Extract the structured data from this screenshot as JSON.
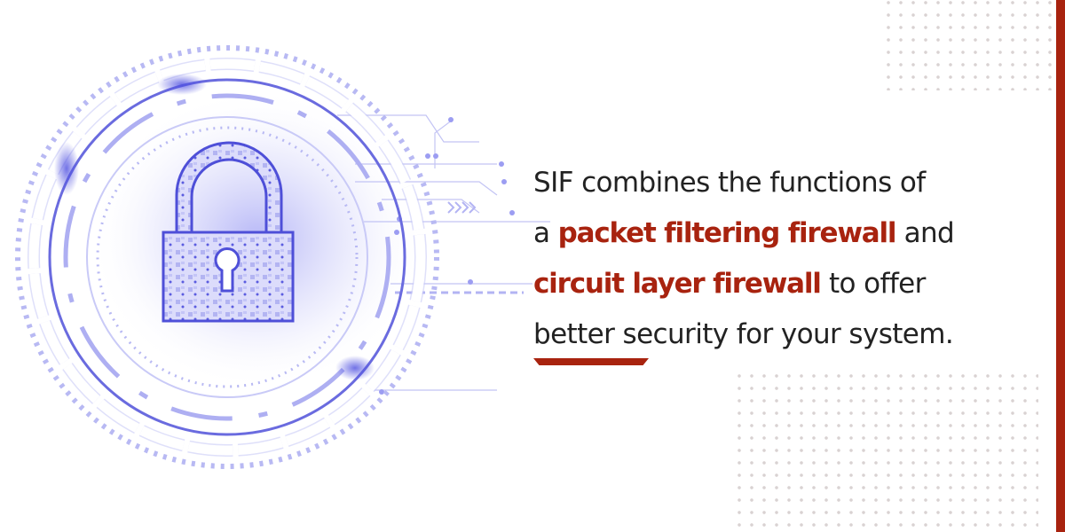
{
  "graphic": {
    "icon": "padlock-icon",
    "description": "Open padlock with circuit texture inside concentric tech rings"
  },
  "message": {
    "line1": "SIF combines the functions of",
    "line2_prefix": "a ",
    "line2_highlight": "packet filtering firewall",
    "line2_suffix": " and",
    "line3_highlight": "circuit layer firewall",
    "line3_suffix": " to offer",
    "line4": "better security for your system."
  },
  "colors": {
    "accent": "#a8230f",
    "graphic": "#5b5ce0",
    "text": "#222222",
    "dots": "#d9d2d2"
  }
}
